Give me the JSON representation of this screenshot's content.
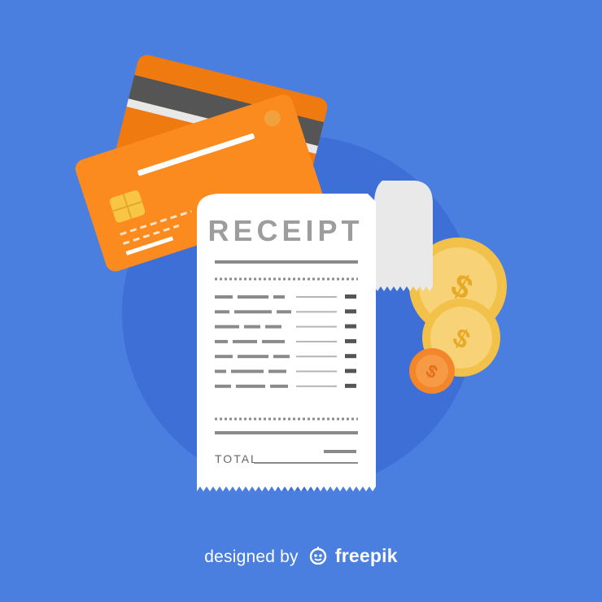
{
  "colors": {
    "background": "#4a7fe0",
    "backdrop_circle": "#3d6fd6",
    "card_front": "#fb8a1f",
    "card_back": "#ef7a10",
    "card_chip": "#f8c545",
    "receipt_paper": "#ffffff",
    "receipt_fold": "#e9e9e9",
    "receipt_title": "#9d9d9d",
    "receipt_lines": "#8a8a8a",
    "coin_gold": "#f2c14a",
    "coin_face": "#f7d277",
    "coin_orange": "#f3862a"
  },
  "receipt": {
    "title": "RECEIPT",
    "total_label": "TOTAL",
    "line_item_count": 7
  },
  "coins": {
    "symbol": "$",
    "count": 3
  },
  "cards": {
    "count": 2
  },
  "credit": {
    "prefix": "designed by",
    "brand": "freepik",
    "icon": "freepik-logo-icon"
  }
}
